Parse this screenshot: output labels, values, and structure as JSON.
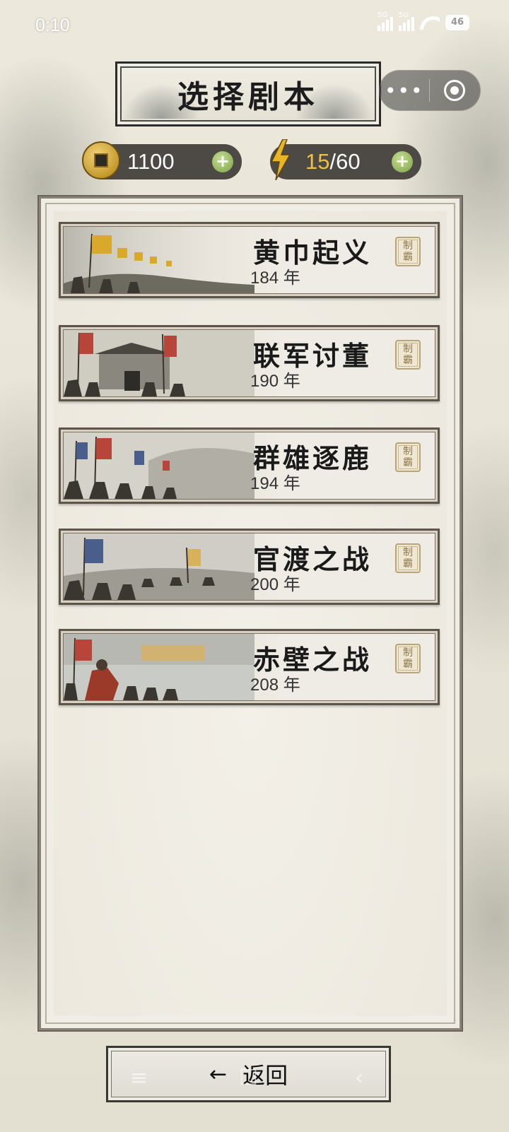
{
  "status_bar": {
    "time": "0:10",
    "signal1": "5G",
    "signal2": "5G",
    "battery": "46"
  },
  "header": {
    "title": "选择剧本"
  },
  "capsule": {
    "more": "•••"
  },
  "resources": {
    "coins": "1100",
    "energy_current": "15",
    "energy_max": "/60",
    "plus": "+"
  },
  "scenarios": [
    {
      "title": "黄巾起义",
      "year": "184 年",
      "seal": [
        "制",
        "霸"
      ]
    },
    {
      "title": "联军讨董",
      "year": "190 年",
      "seal": [
        "制",
        "霸"
      ]
    },
    {
      "title": "群雄逐鹿",
      "year": "194 年",
      "seal": [
        "制",
        "霸"
      ]
    },
    {
      "title": "官渡之战",
      "year": "200 年",
      "seal": [
        "制",
        "霸"
      ]
    },
    {
      "title": "赤壁之战",
      "year": "208 年",
      "seal": [
        "制",
        "霸"
      ]
    }
  ],
  "footer": {
    "back_arrow": "←",
    "back_label": "返回"
  },
  "nav_hints": {
    "menu": "≡",
    "home": "☐",
    "back": "‹"
  },
  "colors": {
    "coin_gold": "#c49a2c",
    "energy_yellow": "#f0c040",
    "plus_green": "#7ea448",
    "ink": "#1a1a1a"
  }
}
